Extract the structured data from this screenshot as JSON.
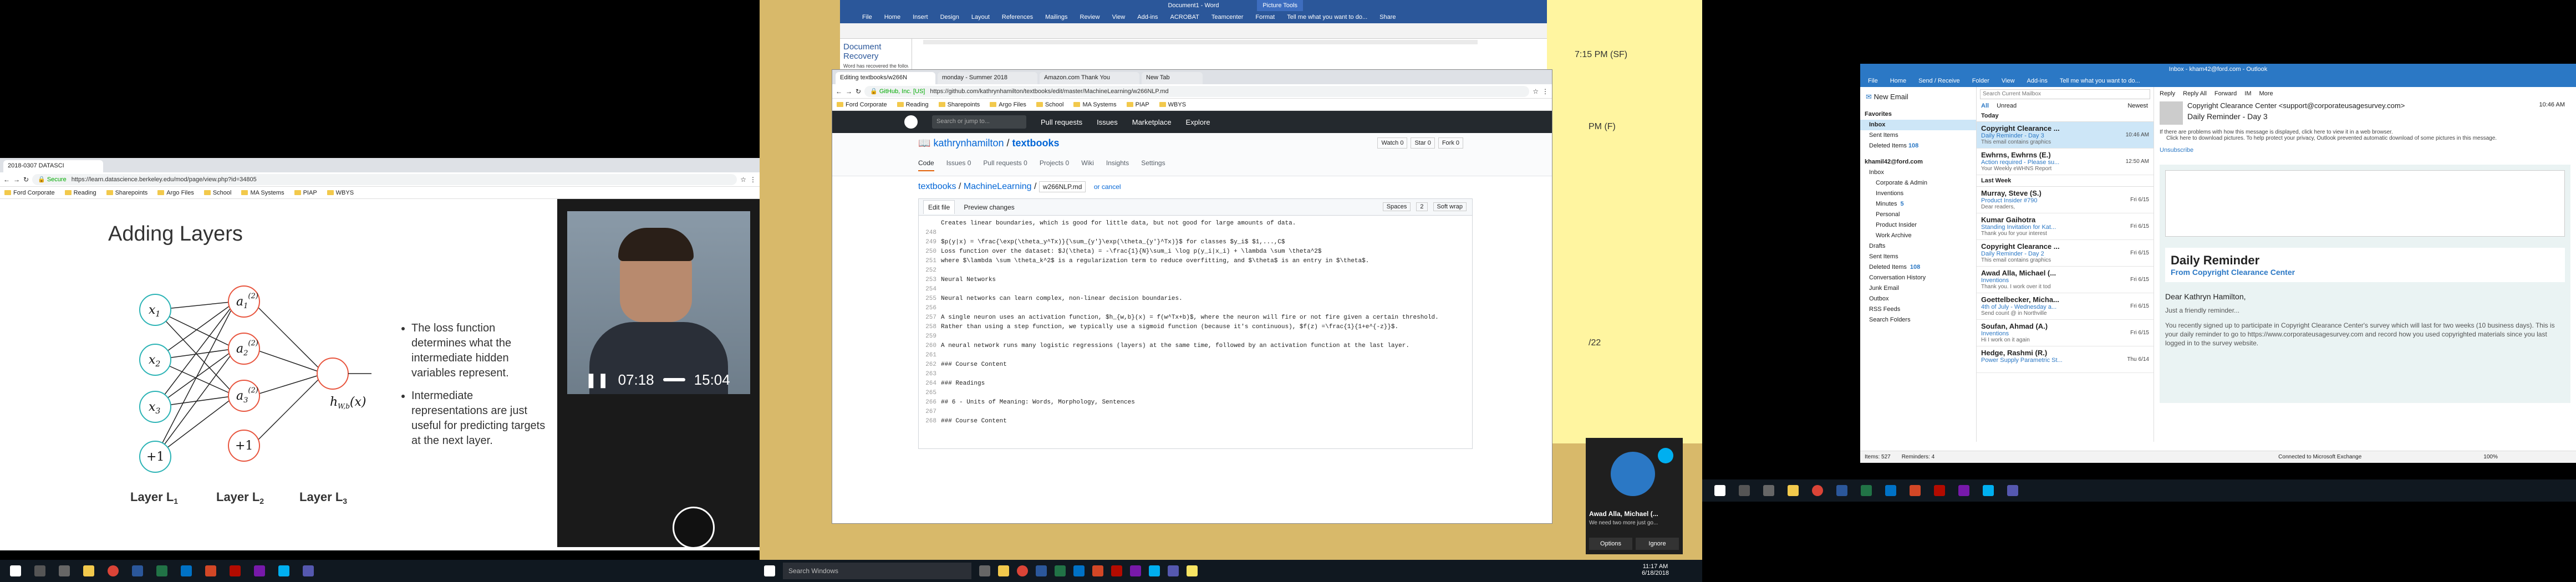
{
  "monitor1": {
    "browser": {
      "tab_title": "2018-0307 DATASCI",
      "url": "https://learn.datascience.berkeley.edu/mod/page/view.php?id=34805",
      "secure_label": "Secure",
      "bookmarks": [
        "Ford Corporate",
        "Reading",
        "Sharepoints",
        "Argo Files",
        "School",
        "MA Systems",
        "PIAP",
        "WBYS"
      ]
    },
    "slide": {
      "title": "Adding Layers",
      "bullets": [
        "The loss function determines what the intermediate hidden variables represent.",
        "Intermediate representations are just useful for predicting targets at the next layer."
      ],
      "input_nodes": [
        "x",
        "x",
        "x",
        "+1"
      ],
      "input_subs": [
        "1",
        "2",
        "3",
        ""
      ],
      "hidden_nodes": [
        "a",
        "a",
        "a",
        "+1"
      ],
      "hidden_subs": [
        "1",
        "2",
        "3",
        ""
      ],
      "hidden_sups": [
        "(2)",
        "(2)",
        "(2)",
        ""
      ],
      "output_label": "h",
      "output_sub": "W,b",
      "output_arg": "(x)",
      "layer_labels": [
        "Layer L",
        "Layer L",
        "Layer L"
      ],
      "layer_subs": [
        "1",
        "2",
        "3"
      ]
    },
    "video": {
      "current_time": "07:18",
      "duration": "15:04"
    }
  },
  "monitor2": {
    "word": {
      "title": "Document1 - Word",
      "tabs": [
        "File",
        "Home",
        "Insert",
        "Design",
        "Layout",
        "References",
        "Mailings",
        "Review",
        "View",
        "Add-ins",
        "ACROBAT",
        "Teamcenter",
        "Format"
      ],
      "tell_me": "Tell me what you want to do...",
      "share_label": "Share",
      "picture_tools": "Picture Tools",
      "recovery_title": "Document Recovery",
      "recovery_text": "Word has recovered the following files."
    },
    "sticky": {
      "lines": [
        "7:15 PM (SF)",
        "PM (F)",
        "/22"
      ]
    },
    "chrome": {
      "tabs": [
        "Editing textbooks/w266N",
        "monday - Summer 2018",
        "Amazon.com Thank You",
        "New Tab"
      ],
      "url": "https://github.com/kathrynhamilton/textbooks/edit/master/MachineLearning/w266NLP.md",
      "secure_label": "GitHub, Inc. [US]",
      "bookmarks": [
        "Ford Corporate",
        "Reading",
        "Sharepoints",
        "Argo Files",
        "School",
        "MA Systems",
        "PIAP",
        "WBYS"
      ],
      "search_placeholder": "Search or jump to...",
      "nav": [
        "Pull requests",
        "Issues",
        "Marketplace",
        "Explore"
      ],
      "repo_owner": "kathrynhamilton",
      "repo_name": "textbooks",
      "watch_label": "Watch",
      "watch_count": "0",
      "star_label": "Star",
      "star_count": "0",
      "fork_label": "Fork",
      "fork_count": "0",
      "repo_tabs": [
        "Code",
        "Issues",
        "Pull requests",
        "Projects",
        "Wiki",
        "Insights",
        "Settings"
      ],
      "repo_tab_counts": [
        "",
        "0",
        "0",
        "0",
        "",
        "",
        ""
      ],
      "breadcrumb": [
        "textbooks",
        "MachineLearning",
        "w266NLP.md"
      ],
      "cancel_label": "or cancel",
      "edit_tabs": [
        "Edit file",
        "Preview changes"
      ],
      "editor_opts": [
        "Spaces",
        "2",
        "Soft wrap"
      ],
      "code_lines": [
        {
          "n": "",
          "t": "Creates linear boundaries, which is good for little data, but not good for large amounts of data."
        },
        {
          "n": "248",
          "t": ""
        },
        {
          "n": "249",
          "t": "$p(y|x) = \\frac{\\exp(\\theta_y^Tx)}{\\sum_{y'}\\exp(\\theta_{y'}^Tx)}$ for classes $y_i$ $1,...,C$"
        },
        {
          "n": "250",
          "t": "Loss function over the dataset: $J(\\theta) = -\\frac{1}{N}\\sum_i \\log p(y_i|x_i) + \\lambda \\sum \\theta^2$"
        },
        {
          "n": "251",
          "t": "where $\\lambda \\sum \\theta_k^2$ is a regularization term to reduce overfitting, and $\\theta$ is an entry in $\\theta$."
        },
        {
          "n": "252",
          "t": ""
        },
        {
          "n": "253",
          "t": "Neural Networks"
        },
        {
          "n": "254",
          "t": ""
        },
        {
          "n": "255",
          "t": "Neural networks can learn complex, non-linear decision boundaries."
        },
        {
          "n": "256",
          "t": ""
        },
        {
          "n": "257",
          "t": "A single neuron uses an activation function, $h_{w,b}(x) = f(w^Tx+b)$, where the neuron will fire or not fire given a certain threshold."
        },
        {
          "n": "258",
          "t": "Rather than using a step function, we typically use a sigmoid function (because it's continuous), $f(z) =\\frac{1}{1+e^{-z}}$."
        },
        {
          "n": "259",
          "t": ""
        },
        {
          "n": "260",
          "t": "A neural network runs many logistic regressions (layers) at the same time, followed by an activation function at the last layer."
        },
        {
          "n": "261",
          "t": ""
        },
        {
          "n": "262",
          "t": "### Course Content"
        },
        {
          "n": "263",
          "t": ""
        },
        {
          "n": "264",
          "t": "### Readings"
        },
        {
          "n": "265",
          "t": ""
        },
        {
          "n": "266",
          "t": "## 6 - Units of Meaning: Words, Morphology, Sentences"
        },
        {
          "n": "267",
          "t": ""
        },
        {
          "n": "268",
          "t": "### Course Content"
        }
      ]
    },
    "taskbar": {
      "search_placeholder": "Search Windows",
      "time": "11:17 AM",
      "date": "6/18/2018"
    },
    "toast": {
      "name": "Awad Alla, Michael (...",
      "message": "We need two more just go...",
      "options_label": "Options",
      "ignore_label": "Ignore"
    }
  },
  "monitor3": {
    "outlook": {
      "title": "Inbox - kham42@ford.com - Outlook",
      "tabs": [
        "File",
        "Home",
        "Send / Receive",
        "Folder",
        "View",
        "Add-ins"
      ],
      "tell_me": "Tell me what you want to do...",
      "new_email": "New Email",
      "favorites_label": "Favorites",
      "favorites": [
        "Inbox",
        "Sent Items",
        "Deleted Items"
      ],
      "favorites_badge": [
        "",
        "",
        "108"
      ],
      "account": "khamil42@ford.com",
      "folders": [
        "Inbox",
        "Corporate & Admin",
        "Inventions",
        "Minutes",
        "Personal",
        "Product Insider",
        "Work Archive",
        "Drafts",
        "Sent Items",
        "Deleted Items",
        "Conversation History",
        "Junk Email",
        "Outbox",
        "RSS Feeds",
        "Search Folders"
      ],
      "folder_badges": [
        "",
        "",
        "",
        "5",
        "",
        "",
        "",
        "",
        "",
        "108",
        "",
        "",
        "",
        "",
        ""
      ],
      "search_placeholder": "Search Current Mailbox",
      "mailbox_scope": "Current Mailbox",
      "filter_tabs": [
        "All",
        "Unread"
      ],
      "sort_label": "Newest",
      "groups": [
        "Today",
        "Last Week"
      ],
      "mails": [
        {
          "from": "Copyright Clearance ...",
          "subj": "Daily Reminder - Day 3",
          "prev": "This email contains graphics",
          "time": "10:46 AM"
        },
        {
          "from": "Ewhrns, Ewhrns (E.)",
          "subj": "Action required - Please su...",
          "prev": "Your Weekly eWHNS Report",
          "time": "12:50 AM"
        },
        {
          "from": "Murray, Steve (S.)",
          "subj": "Product Insider #790",
          "prev": "Dear readers,",
          "time": "Fri 6/15"
        },
        {
          "from": "Kumar Gaihotra",
          "subj": "Standing Invitation for Kat...",
          "prev": "Thank you for your interest",
          "time": "Fri 6/15"
        },
        {
          "from": "Copyright Clearance ...",
          "subj": "Daily Reminder - Day 2",
          "prev": "This email contains graphics",
          "time": "Fri 6/15"
        },
        {
          "from": "Awad Alla, Michael (...",
          "subj": "Inventions",
          "prev": "Thank you. I work over it tod",
          "time": "Fri 6/15"
        },
        {
          "from": "Goettelbecker, Micha...",
          "subj": "4th of July - Wednesday a...",
          "prev": "Send count @ in Northville",
          "time": "Fri 6/15"
        },
        {
          "from": "Soufan, Ahmad (A.)",
          "subj": "Inventions",
          "prev": "Hi I work on it again",
          "time": "Fri 6/15"
        },
        {
          "from": "Hedge, Rashmi (R.)",
          "subj": "Power Supply Parametric St...",
          "prev": "",
          "time": "Thu 6/14"
        }
      ],
      "reading": {
        "actions": [
          "Reply",
          "Reply All",
          "Forward",
          "IM",
          "More"
        ],
        "sender": "Copyright Clearance Center <support@corporateusagesurvey.com>",
        "subject": "Daily Reminder - Day 3",
        "time": "10:46 AM",
        "info_lines": [
          "If there are problems with how this message is displayed, click here to view it in a web browser.",
          "Click here to download pictures. To help protect your privacy, Outlook prevented automatic download of some pictures in this message."
        ],
        "unsubscribe": "Unsubscribe",
        "header_title": "Daily Reminder",
        "header_sub": "From Copyright Clearance Center",
        "greeting": "Dear Kathryn Hamilton,",
        "body1": "Just a friendly reminder...",
        "body2": "You recently signed up to participate in Copyright Clearance Center's survey which will last for two weeks (10 business days). This is your daily reminder to go to https://www.corporateusagesurvey.com and record how you used copyrighted materials since you last logged in to the survey website."
      },
      "status": {
        "items": "Items: 527",
        "reminders": "Reminders: 4",
        "connection": "Connected to Microsoft Exchange",
        "zoom": "100%"
      }
    }
  }
}
